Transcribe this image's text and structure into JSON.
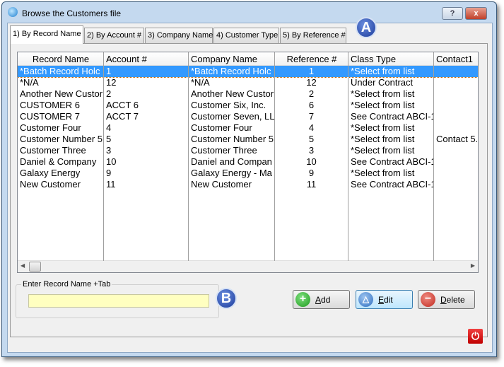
{
  "window": {
    "title": "Browse the Customers file",
    "help_label": "?",
    "close_label": "x"
  },
  "tabs": [
    {
      "label": "1) By Record Name"
    },
    {
      "label": "2) By Account #"
    },
    {
      "label": "3) Company Name"
    },
    {
      "label": "4) Customer Type"
    },
    {
      "label": "5) By Reference #"
    }
  ],
  "columns": [
    "Record Name",
    "Account #",
    "Company Name",
    "Reference #",
    "Class Type",
    "Contact1"
  ],
  "rows": [
    [
      "*Batch Record Holc",
      "1",
      "*Batch Record Holc",
      "1",
      "*Select from list",
      ""
    ],
    [
      "*N/A",
      "12",
      "*N/A",
      "12",
      "Under Contract",
      ""
    ],
    [
      "Another New Custor",
      "2",
      "Another New Custor",
      "2",
      "*Select from list",
      ""
    ],
    [
      "CUSTOMER 6",
      "ACCT 6",
      "Customer Six, Inc.",
      "6",
      "*Select from list",
      ""
    ],
    [
      "CUSTOMER 7",
      "ACCT 7",
      "Customer Seven, LL",
      "7",
      "See Contract ABCI-1",
      ""
    ],
    [
      "Customer Four",
      "4",
      "Customer Four",
      "4",
      "*Select from list",
      ""
    ],
    [
      "Customer Number 5",
      "5",
      "Customer Number 5",
      "5",
      "*Select from list",
      "Contact 5."
    ],
    [
      "Customer Three",
      "3",
      "Customer Three",
      "3",
      "*Select from list",
      ""
    ],
    [
      "Daniel & Company",
      "10",
      "Daniel and Compan",
      "10",
      "See Contract ABCI-1",
      ""
    ],
    [
      "Galaxy Energy",
      "9",
      "Galaxy Energy - Ma",
      "9",
      "*Select from list",
      ""
    ],
    [
      "New Customer",
      "11",
      "New Customer",
      "11",
      "See Contract ABCI-1",
      ""
    ]
  ],
  "search": {
    "label": "Enter Record Name +Tab",
    "value": ""
  },
  "badges": {
    "a": "A",
    "b": "B"
  },
  "buttons": {
    "add": {
      "key": "A",
      "rest": "dd"
    },
    "edit": {
      "key": "E",
      "rest": "dit"
    },
    "delete": {
      "key": "D",
      "rest": "elete"
    }
  }
}
